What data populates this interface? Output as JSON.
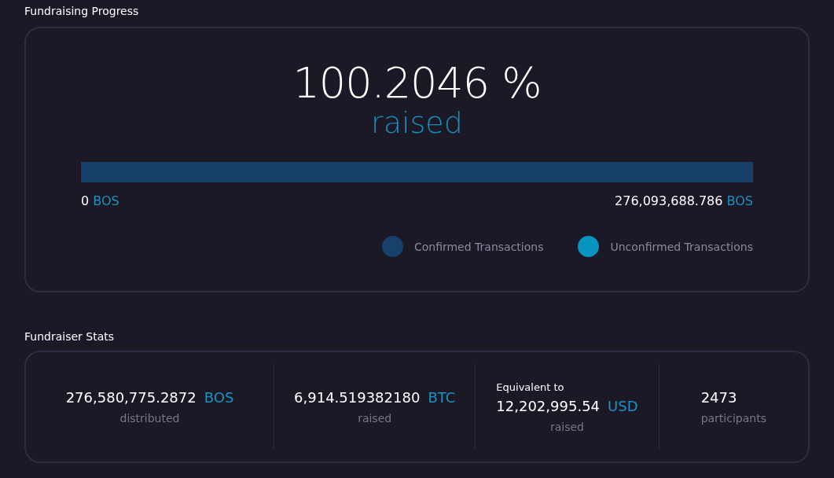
{
  "progress": {
    "title": "Fundraising Progress",
    "percent": "100.2046 %",
    "caption": "raised",
    "level": 1,
    "min_value": "0",
    "min_unit": "BOS",
    "max_value": "276,093,688.786",
    "max_unit": "BOS",
    "legend": [
      {
        "label": "Confirmed Transactions",
        "color": "#17406b"
      },
      {
        "label": "Unconfirmed Transactions",
        "color": "#0894c1"
      }
    ]
  },
  "stats": {
    "title": "Fundraiser Stats",
    "items": [
      {
        "value": "276,580,775.2872",
        "unit": "BOS",
        "caption": "distributed"
      },
      {
        "value": "6,914.519382180",
        "unit": "BTC",
        "caption": "raised"
      },
      {
        "prefix": "Equivalent to",
        "value": "12,202,995.54",
        "unit": "USD",
        "caption": "raised"
      },
      {
        "value": "2473",
        "caption": "participants"
      }
    ]
  }
}
